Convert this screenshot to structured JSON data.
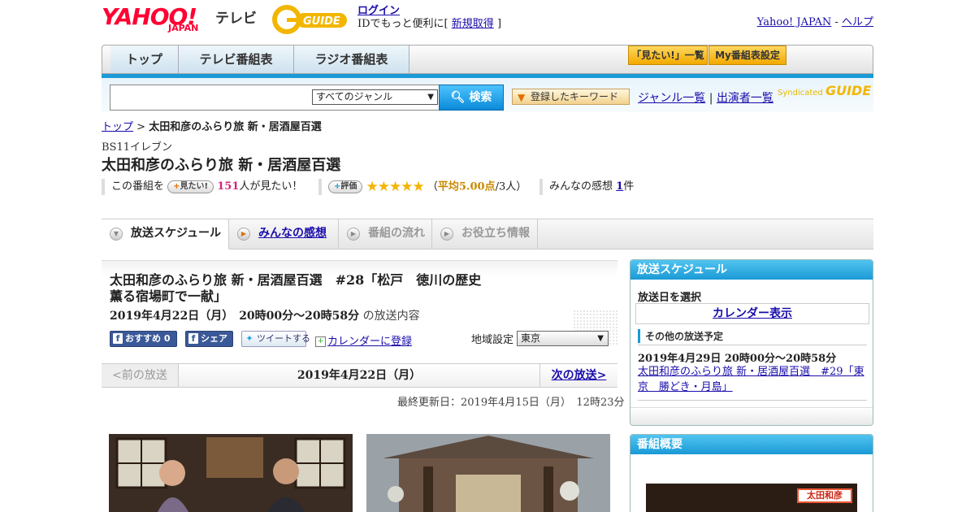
{
  "header": {
    "logo_yahoo": "YAHOO!",
    "logo_japan": "JAPAN",
    "logo_tv": "テレビ",
    "logo_gguide": "G GUIDE",
    "login_link": "ログイン",
    "login_text": "IDでもっと便利に[",
    "signup_link": "新規取得",
    "login_close": "]",
    "yahoo_japan_link": "Yahoo! JAPAN",
    "sep": "-",
    "help_link": "ヘルプ"
  },
  "nav": {
    "tabs": [
      "トップ",
      "テレビ番組表",
      "ラジオ番組表"
    ],
    "mitai_list": "「見たい!」一覧",
    "my_settings": "My番組表設定"
  },
  "search": {
    "genre_selected": "すべてのジャンル",
    "search_button": "検索",
    "keyword_button": "登録したキーワード",
    "genre_list": "ジャンル一覧",
    "divider": "|",
    "cast_list": "出演者一覧",
    "syndicated": "Syndicated",
    "syndicated_logo": "GUIDE"
  },
  "breadcrumb": {
    "top": "トップ",
    "sep": ">",
    "current": "太田和彦のふらり旅 新・居酒屋百選"
  },
  "program": {
    "channel": "BS11イレブン",
    "title": "太田和彦のふらり旅 新・居酒屋百選"
  },
  "stats": {
    "prefix": "この番組を",
    "mitai_pill": "見たい!",
    "mitai_count": "151",
    "mitai_suffix": "人が見たい！",
    "rate_pill": "評価",
    "stars": "★★★★★",
    "rating_open": "（",
    "rating_avg": "平均5.00点",
    "rating_count": "/3人）",
    "review_label": "みんなの感想",
    "review_count": "1",
    "review_suffix": "件"
  },
  "section_tabs": [
    "放送スケジュール",
    "みんなの感想",
    "番組の流れ",
    "お役立ち情報"
  ],
  "episode": {
    "title": "太田和彦のふらり旅 新・居酒屋百選　#28「松戸　徳川の歴史薫る宿場町で一献」",
    "datetime": "2019年4月22日（月）　20時00分～20時58分",
    "datetime_suffix": "の放送内容",
    "fb_recommend": "おすすめ 0",
    "fb_share": "シェア",
    "tweet": "ツイートする",
    "calendar_register": "カレンダーに登録",
    "region_label": "地域設定",
    "region_value": "東京"
  },
  "pager": {
    "prev": "<前の放送",
    "date": "2019年4月22日（月）",
    "next": "次の放送>"
  },
  "updated": "最終更新日：2019年4月15日（月）　12時23分",
  "sidebar": {
    "schedule_heading": "放送スケジュール",
    "select_date": "放送日を選択",
    "calendar_button": "カレンダー表示",
    "other_label": "その他の放送予定",
    "other_time": "2019年4月29日  20時00分～20時58分",
    "other_title": "太田和彦のふらり旅 新・居酒屋百選　#29「東京　勝どき・月島」",
    "overview_heading": "番組概要",
    "overview_sign": "太田和彦"
  },
  "colors": {
    "accent_blue": "#1a9ad6",
    "yahoo_red": "#ff0033",
    "star_gold": "#f4b400",
    "mitai_pink": "#d0267a"
  }
}
